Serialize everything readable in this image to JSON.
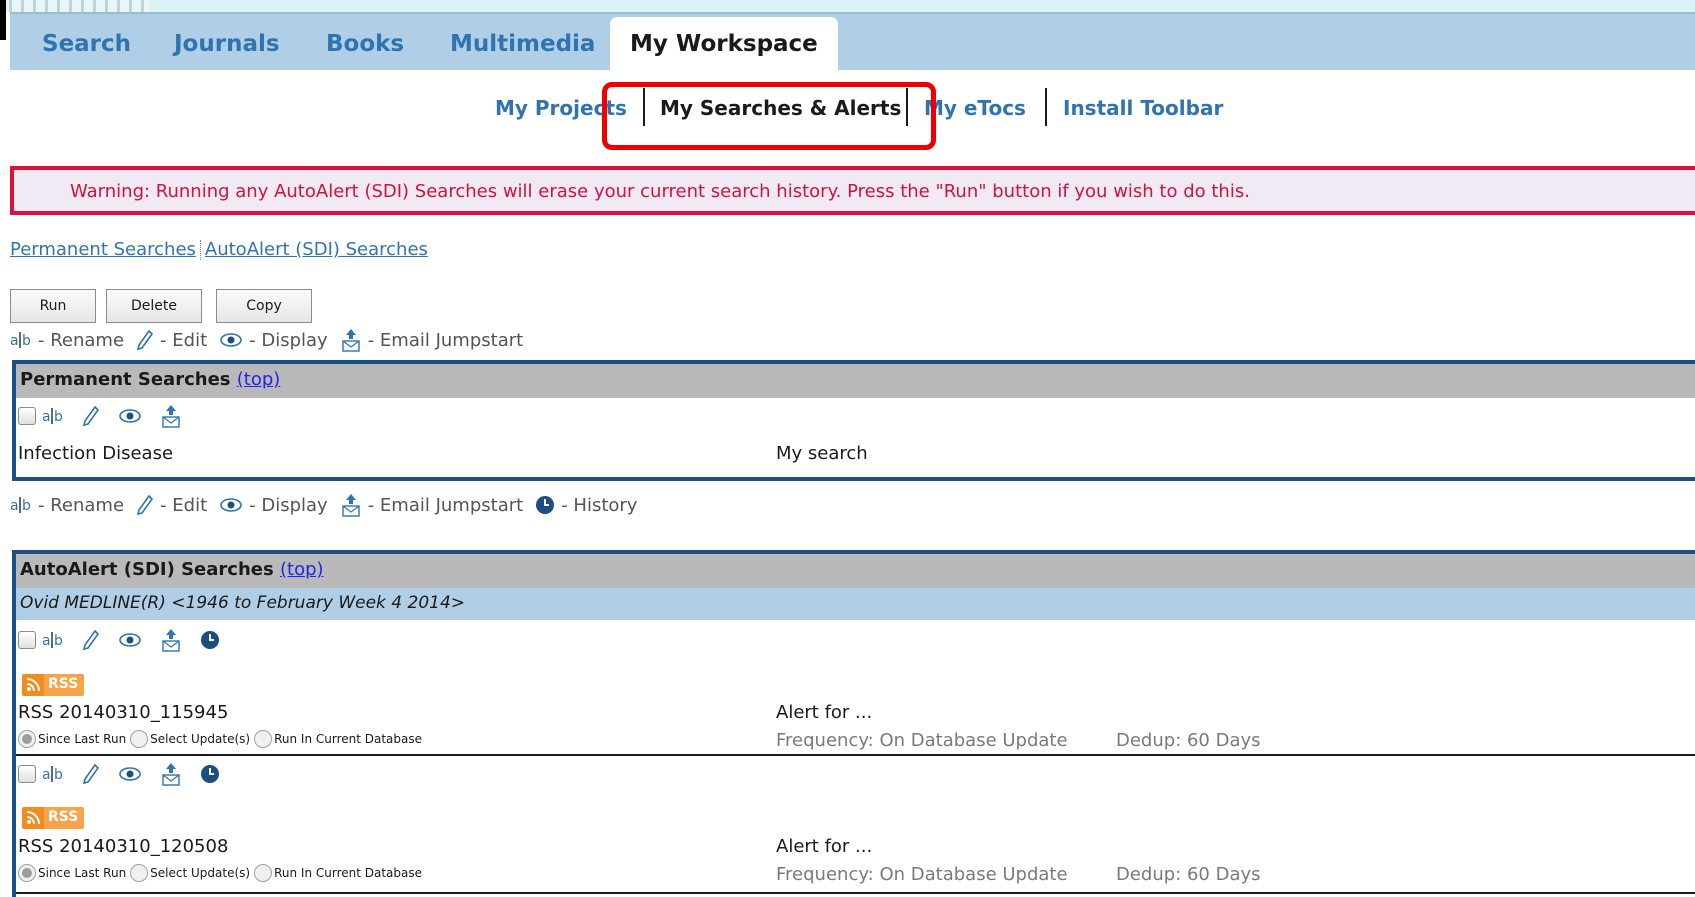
{
  "tabs": [
    {
      "label": "Search"
    },
    {
      "label": "Journals"
    },
    {
      "label": "Books"
    },
    {
      "label": "Multimedia"
    },
    {
      "label": "My Workspace",
      "active": true
    }
  ],
  "subnav": {
    "projects": "My Projects",
    "searches": "My Searches & Alerts",
    "etocs": "My eTocs",
    "toolbar": "Install Toolbar"
  },
  "warning": "Warning: Running any AutoAlert (SDI) Searches will erase your current search history. Press the \"Run\" button if you wish to do this.",
  "quicklinks": {
    "permanent": "Permanent Searches",
    "autoalert": "AutoAlert (SDI) Searches"
  },
  "buttons": {
    "run": "Run",
    "delete": "Delete",
    "copy": "Copy"
  },
  "legend": {
    "rename": "- Rename",
    "edit": "- Edit",
    "display": "- Display",
    "email": "- Email Jumpstart",
    "history": "- History"
  },
  "permanent": {
    "title": "Permanent Searches",
    "top_link": "(top)",
    "items": [
      {
        "name": "Infection Disease",
        "comment": "My search"
      }
    ]
  },
  "autoalert": {
    "title": "AutoAlert (SDI) Searches",
    "top_link": "(top)",
    "database": "Ovid MEDLINE(R) <1946 to February Week 4 2014>",
    "rss_label": "RSS",
    "radio_labels": [
      "Since Last Run",
      "Select Update(s)",
      "Run In Current Database"
    ],
    "items": [
      {
        "name": "RSS 20140310_115945",
        "comment": "Alert for ...",
        "frequency": "Frequency: On Database Update",
        "dedup": "Dedup: 60 Days"
      },
      {
        "name": "RSS 20140310_120508",
        "comment": "Alert for ...",
        "frequency": "Frequency: On Database Update",
        "dedup": "Dedup: 60 Days"
      }
    ]
  },
  "colors": {
    "tab_bar": "#b0cfe6",
    "link_blue": "#2f74b0",
    "warning_red": "#d4103c",
    "highlight_red": "#ee0000",
    "panel_border": "#1d4e82"
  }
}
